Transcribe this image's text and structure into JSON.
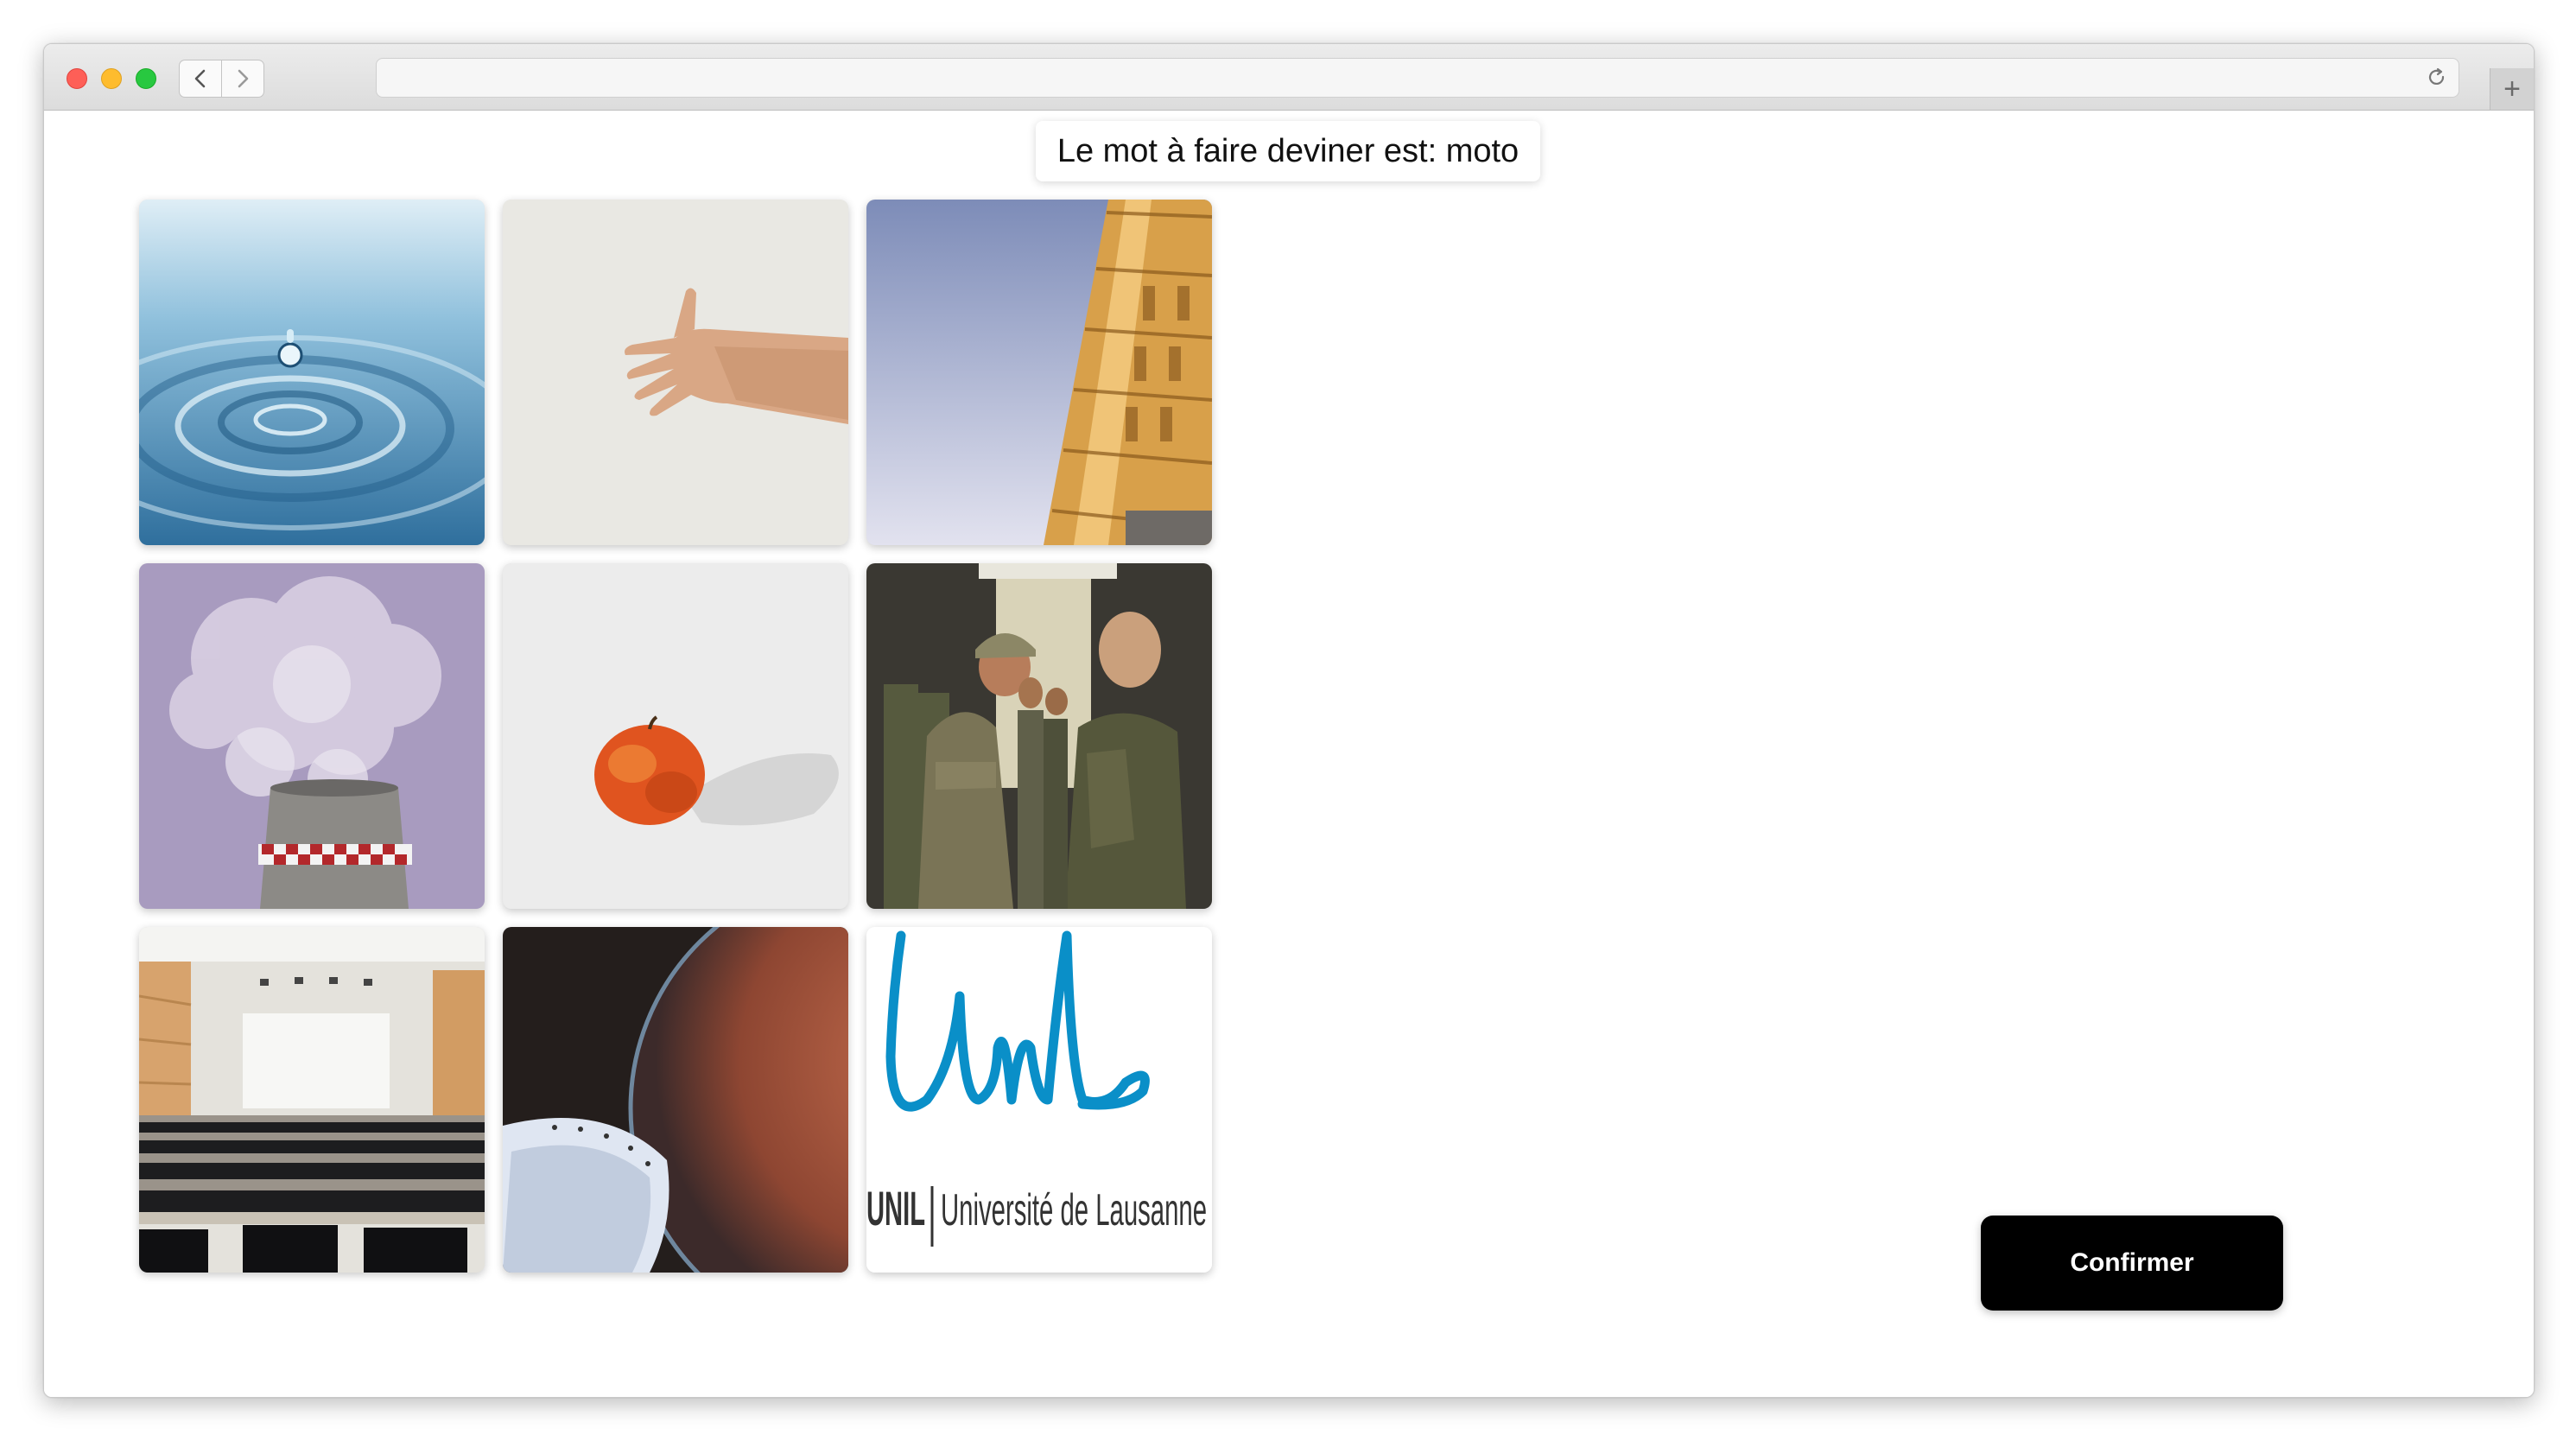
{
  "prompt": {
    "text": "Le mot à faire deviner est: moto"
  },
  "actions": {
    "confirm_label": "Confirmer"
  },
  "url_bar": {
    "value": ""
  },
  "tiles": [
    {
      "subject": "water droplet"
    },
    {
      "subject": "hand"
    },
    {
      "subject": "leaning tower of Pisa"
    },
    {
      "subject": "cooling tower with smoke"
    },
    {
      "subject": "apple"
    },
    {
      "subject": "soldiers"
    },
    {
      "subject": "conference hall"
    },
    {
      "subject": "planet and spacecraft"
    },
    {
      "subject": "UNIL logo",
      "logo_text": "UNIL",
      "logo_subtitle": "Université de Lausanne",
      "logo_script": "Unil"
    }
  ],
  "colors": {
    "unil_blue": "#0a8fc8",
    "confirm_bg": "#000000",
    "confirm_text": "#ffffff"
  }
}
